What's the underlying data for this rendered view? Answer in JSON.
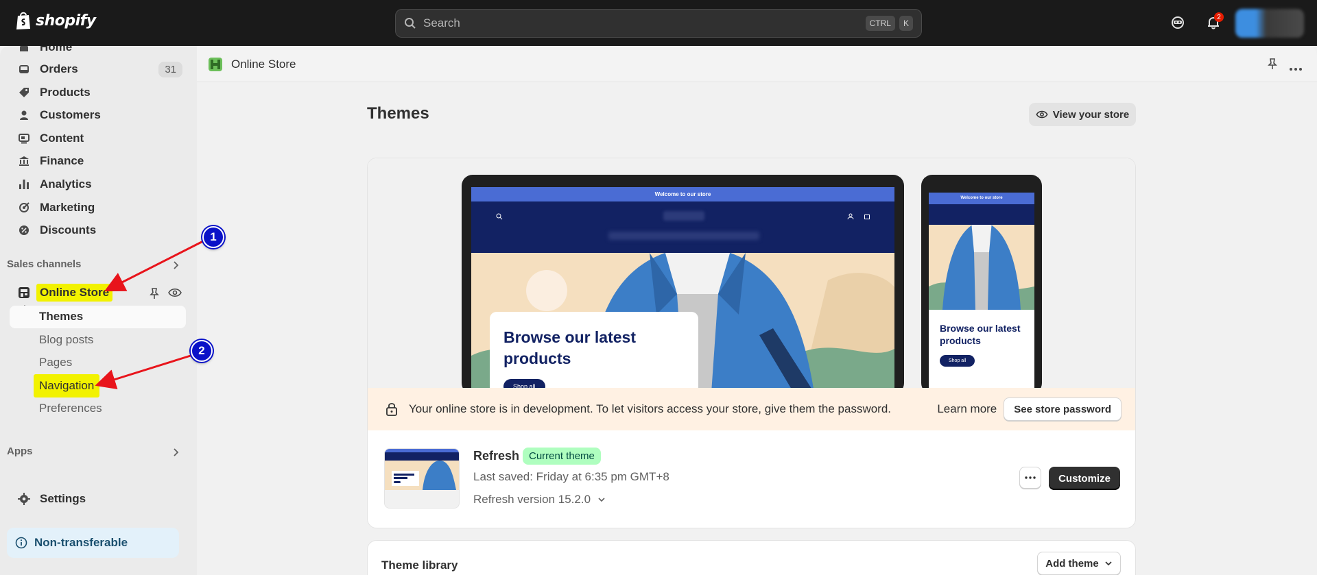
{
  "topbar": {
    "brand": "shopify",
    "search_placeholder": "Search",
    "shortcut_key1": "CTRL",
    "shortcut_key2": "K",
    "notification_count": "2"
  },
  "sidebar": {
    "items": [
      {
        "label": "Home"
      },
      {
        "label": "Orders",
        "count": "31"
      },
      {
        "label": "Products"
      },
      {
        "label": "Customers"
      },
      {
        "label": "Content"
      },
      {
        "label": "Finance"
      },
      {
        "label": "Analytics"
      },
      {
        "label": "Marketing"
      },
      {
        "label": "Discounts"
      }
    ],
    "sales_channels_label": "Sales channels",
    "online_store_label": "Online Store",
    "sub_items": [
      "Themes",
      "Blog posts",
      "Pages",
      "Navigation",
      "Preferences"
    ],
    "apps_label": "Apps",
    "settings_label": "Settings",
    "non_transferable_label": "Non-transferable"
  },
  "main": {
    "breadcrumb": "Online Store",
    "title": "Themes",
    "view_store_label": "View your store"
  },
  "preview": {
    "announcement": "Welcome to our store",
    "hero_title": "Browse our latest products",
    "shop_button": "Shop all"
  },
  "banner": {
    "text": "Your online store is in development. To let visitors access your store, give them the password.",
    "learn_more": "Learn more",
    "button": "See store password"
  },
  "current_theme": {
    "name": "Refresh",
    "badge": "Current theme",
    "last_saved": "Last saved: Friday at 6:35 pm GMT+8",
    "version": "Refresh version 15.2.0",
    "customize_label": "Customize"
  },
  "library": {
    "title": "Theme library",
    "add_theme_label": "Add theme"
  },
  "annotations": {
    "marker1": "1",
    "marker2": "2",
    "arrow_color": "#e8141b",
    "highlight_color": "#f2f200"
  }
}
